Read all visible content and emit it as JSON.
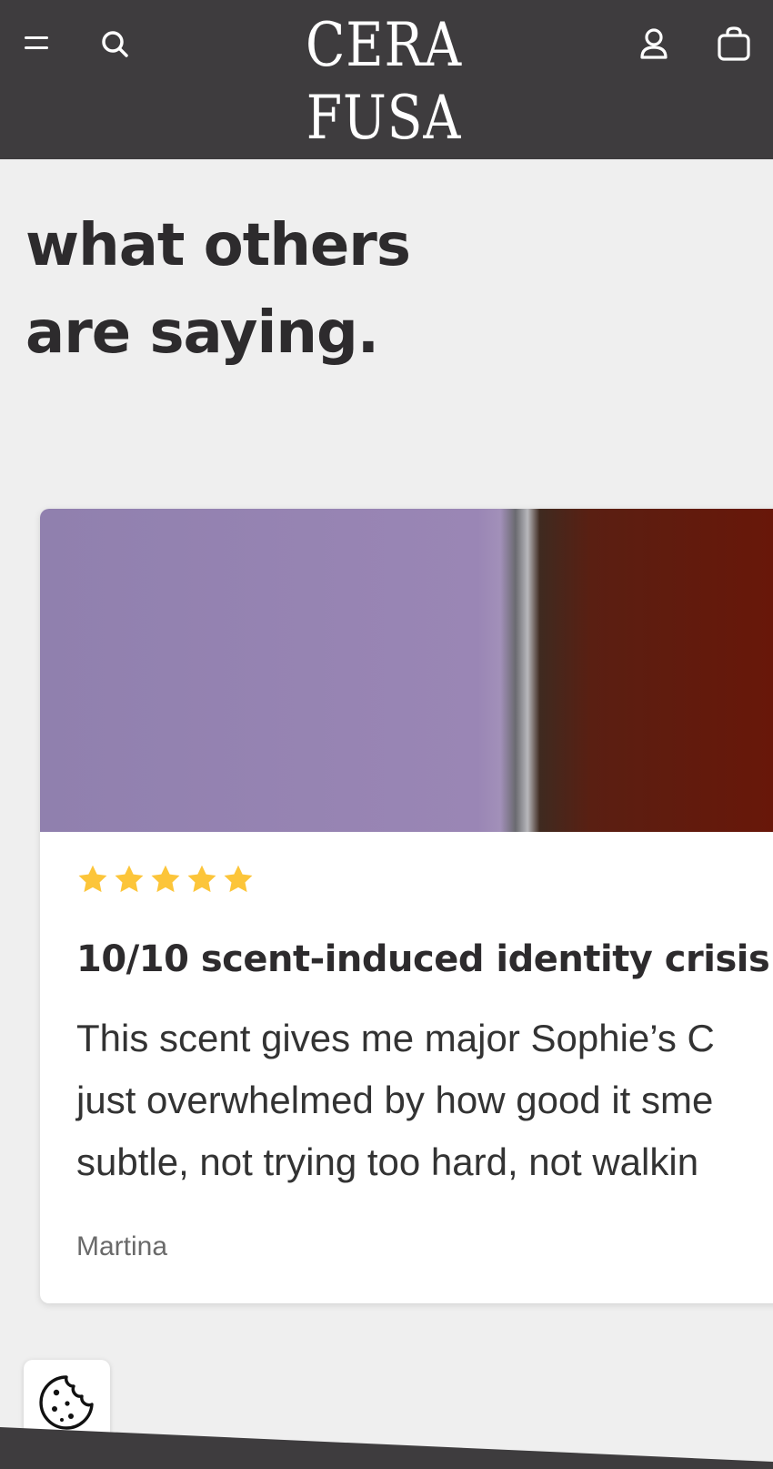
{
  "header": {
    "logo_text": "CERA FUSA",
    "icons": [
      "menu-icon",
      "search-icon",
      "account-icon",
      "cart-icon"
    ]
  },
  "section": {
    "heading_line1": "what others",
    "heading_line2": "are saying."
  },
  "review": {
    "rating": 5,
    "rating_max": 5,
    "title": "10/10 scent-induced identity crisis",
    "body_lines": [
      "This scent gives me major Sophie’s C",
      "just overwhelmed by how good it sme",
      "subtle, not trying too hard, not walkin"
    ],
    "author": "Martina"
  },
  "colors": {
    "header_bg": "#3e3c3e",
    "page_bg": "#efefef",
    "star": "#fcc53a",
    "heading_text": "#2d2b2d"
  },
  "cookie_button": {
    "icon": "cookie-icon"
  }
}
